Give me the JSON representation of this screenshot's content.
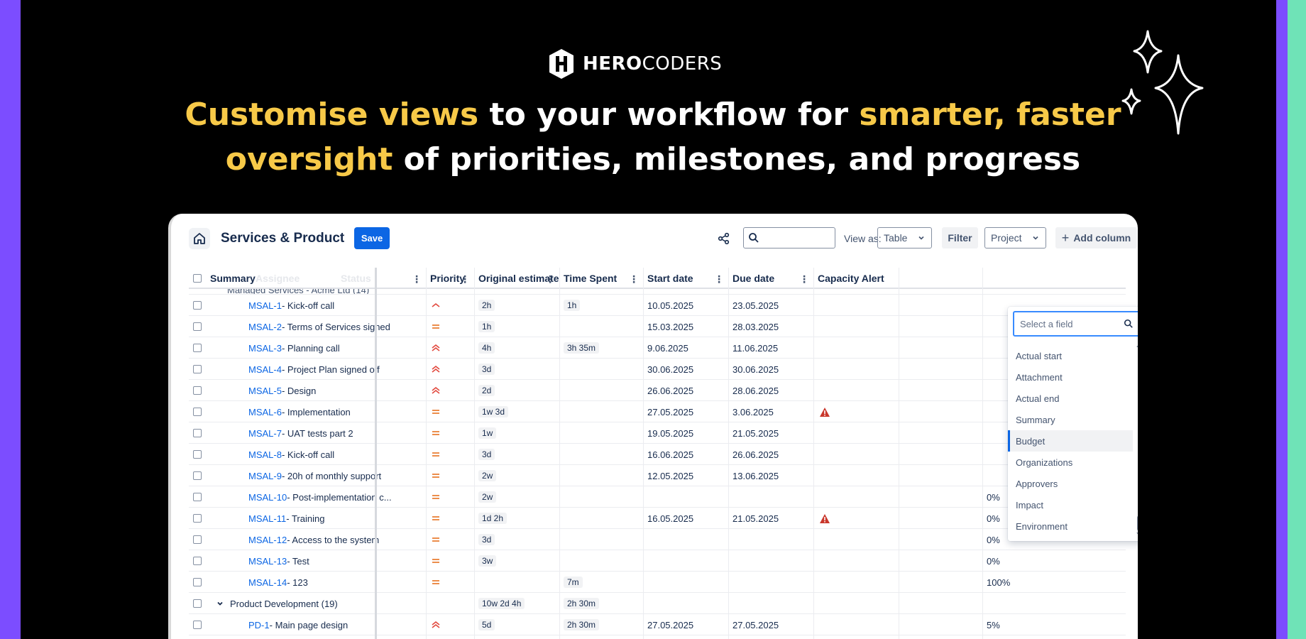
{
  "brand": {
    "bold": "HERO",
    "light": "CODERS"
  },
  "headline": {
    "l1_hl": "Customise views",
    "l1_rest": " to your workflow for ",
    "l1_hl2": "smarter, faster",
    "l2_hl": "oversight",
    "l2_rest": " of priorities, milestones, and progress"
  },
  "colors": {
    "accent": "#f7c948",
    "brand_purple": "#7c4dff",
    "brand_green": "#6fe3b7",
    "save_blue": "#0c66e4"
  },
  "toolbar": {
    "title": "Services & Product",
    "save_label": "Save",
    "view_as_label": "View as:",
    "view_as_value": "Table",
    "filter_label": "Filter",
    "project_value": "Project",
    "add_column_label": "Add column"
  },
  "columns": {
    "summary": "Summary",
    "assignee": "Assignee",
    "status": "Status",
    "priority": "Priority",
    "original_estimate": "Original estimate",
    "time_spent": "Time Spent",
    "start_date": "Start date",
    "due_date": "Due date",
    "capacity_alert": "Capacity Alert"
  },
  "partial_group": "Managed Services - Acme Ltd (14)",
  "rows": [
    {
      "key": "MSAL-1",
      "title": " - Kick-off call",
      "priority": "low",
      "estimate": "2h",
      "spent": "1h",
      "start": "10.05.2025",
      "due": "23.05.2025",
      "alert": false,
      "progress": ""
    },
    {
      "key": "MSAL-2",
      "title": " - Terms of Services signed",
      "priority": "medium",
      "estimate": "1h",
      "spent": "",
      "start": "15.03.2025",
      "due": "28.03.2025",
      "alert": false,
      "progress": ""
    },
    {
      "key": "MSAL-3",
      "title": " - Planning call",
      "priority": "high",
      "estimate": "4h",
      "spent": "3h 35m",
      "start": "9.06.2025",
      "due": "11.06.2025",
      "alert": false,
      "progress": ""
    },
    {
      "key": "MSAL-4",
      "title": " - Project Plan signed off",
      "priority": "high",
      "estimate": "3d",
      "spent": "",
      "start": "30.06.2025",
      "due": "30.06.2025",
      "alert": false,
      "progress": ""
    },
    {
      "key": "MSAL-5",
      "title": " - Design",
      "priority": "high",
      "estimate": "2d",
      "spent": "",
      "start": "26.06.2025",
      "due": "28.06.2025",
      "alert": false,
      "progress": ""
    },
    {
      "key": "MSAL-6",
      "title": " - Implementation",
      "priority": "medium",
      "estimate": "1w 3d",
      "spent": "",
      "start": "27.05.2025",
      "due": "3.06.2025",
      "alert": true,
      "progress": ""
    },
    {
      "key": "MSAL-7",
      "title": " - UAT tests part 2",
      "priority": "medium",
      "estimate": "1w",
      "spent": "",
      "start": "19.05.2025",
      "due": "21.05.2025",
      "alert": false,
      "progress": ""
    },
    {
      "key": "MSAL-8",
      "title": " - Kick-off call",
      "priority": "medium",
      "estimate": "3d",
      "spent": "",
      "start": "16.06.2025",
      "due": "26.06.2025",
      "alert": false,
      "progress": ""
    },
    {
      "key": "MSAL-9",
      "title": " - 20h of monthly support",
      "priority": "medium",
      "estimate": "2w",
      "spent": "",
      "start": "12.05.2025",
      "due": "13.06.2025",
      "alert": false,
      "progress": ""
    },
    {
      "key": "MSAL-10",
      "title": " - Post-implementation c...",
      "priority": "medium",
      "estimate": "2w",
      "spent": "",
      "start": "",
      "due": "",
      "alert": false,
      "progress": "0%"
    },
    {
      "key": "MSAL-11",
      "title": " - Training",
      "priority": "medium",
      "estimate": "1d 2h",
      "spent": "",
      "start": "16.05.2025",
      "due": "21.05.2025",
      "alert": true,
      "progress": "0%"
    },
    {
      "key": "MSAL-12",
      "title": " - Access to the system",
      "priority": "medium",
      "estimate": "3d",
      "spent": "",
      "start": "",
      "due": "",
      "alert": false,
      "progress": "0%"
    },
    {
      "key": "MSAL-13",
      "title": " - Test",
      "priority": "medium",
      "estimate": "3w",
      "spent": "",
      "start": "",
      "due": "",
      "alert": false,
      "progress": "0%"
    },
    {
      "key": "MSAL-14",
      "title": " - 123",
      "priority": "medium",
      "estimate": "",
      "spent": "7m",
      "start": "",
      "due": "",
      "alert": false,
      "progress": "100%"
    }
  ],
  "group2": {
    "label": "Product Development (19)",
    "estimate": "10w 2d 4h",
    "spent": "2h 30m"
  },
  "pd_row": {
    "key": "PD-1",
    "title": " - Main page design",
    "priority": "high",
    "estimate": "5d",
    "spent": "2h 30m",
    "start": "27.05.2025",
    "due": "27.05.2025",
    "progress": "5%"
  },
  "field_picker": {
    "placeholder": "Select a field",
    "items": [
      "Actual start",
      "Attachment",
      "Actual end",
      "Summary",
      "Budget",
      "Organizations",
      "Approvers",
      "Impact",
      "Environment"
    ],
    "selected": "Budget"
  }
}
